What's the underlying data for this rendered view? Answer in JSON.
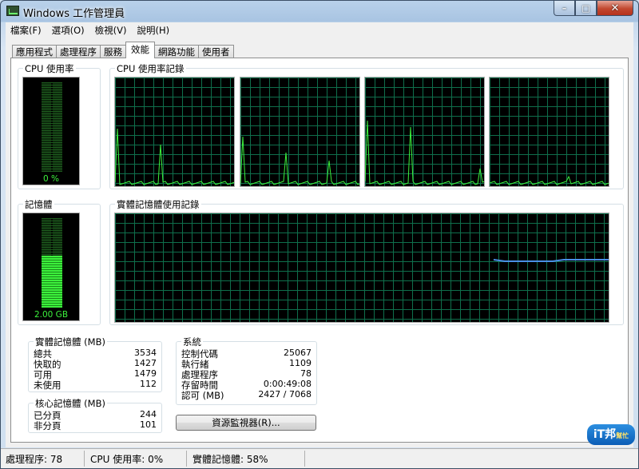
{
  "window": {
    "title": "Windows 工作管理員"
  },
  "caption": {
    "min": "–",
    "max": "□",
    "close": "✕"
  },
  "menu": [
    "檔案(F)",
    "選項(O)",
    "檢視(V)",
    "說明(H)"
  ],
  "tabs": [
    "應用程式",
    "處理程序",
    "服務",
    "效能",
    "網路功能",
    "使用者"
  ],
  "active_tab": "效能",
  "cpu_usage": {
    "label": "CPU 使用率",
    "value_text": "0 %",
    "percent": 0
  },
  "cpu_history": {
    "label": "CPU 使用率記錄",
    "cores": 4
  },
  "memory": {
    "label": "記憶體",
    "value_text": "2.00 GB",
    "percent": 58
  },
  "memory_history": {
    "label": "實體記憶體使用記錄"
  },
  "physical_memory": {
    "label": "實體記憶體 (MB)",
    "rows": [
      {
        "name": "總共",
        "value": "3534"
      },
      {
        "name": "快取的",
        "value": "1427"
      },
      {
        "name": "可用",
        "value": "1479"
      },
      {
        "name": "未使用",
        "value": "112"
      }
    ]
  },
  "kernel_memory": {
    "label": "核心記憶體 (MB)",
    "rows": [
      {
        "name": "已分頁",
        "value": "244"
      },
      {
        "name": "非分頁",
        "value": "101"
      }
    ]
  },
  "system": {
    "label": "系統",
    "rows": [
      {
        "name": "控制代碼",
        "value": "25067"
      },
      {
        "name": "執行緒",
        "value": "1109"
      },
      {
        "name": "處理程序",
        "value": "78"
      },
      {
        "name": "存留時間",
        "value": "0:00:49:08"
      },
      {
        "name": "認可 (MB)",
        "value": "2427 / 7068"
      }
    ]
  },
  "resource_monitor_button": "資源監視器(R)...",
  "status": {
    "processes": "處理程序: 78",
    "cpu": "CPU 使用率: 0%",
    "memory": "實體記憶體: 58%"
  },
  "watermark": {
    "text": "iT邦",
    "sub": "幫忙"
  },
  "colors": {
    "graph_line": "#3cf03c",
    "memory_line": "#4a8fe6",
    "grid": "#0f6f4c"
  }
}
